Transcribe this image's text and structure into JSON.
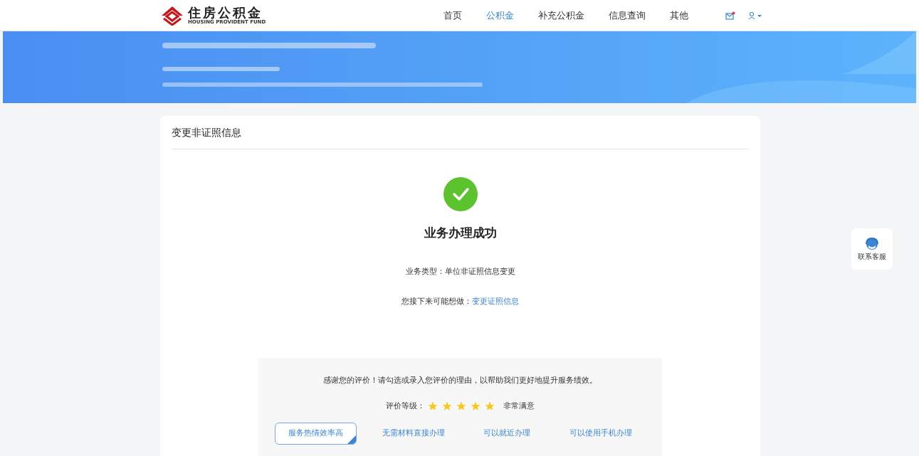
{
  "header": {
    "logo": {
      "title": "住房公积金",
      "subtitle": "HOUSING PROVIDENT FUND"
    },
    "nav": [
      {
        "label": "首页",
        "selected": false
      },
      {
        "label": "公积金",
        "selected": true
      },
      {
        "label": "补充公积金",
        "selected": false
      },
      {
        "label": "信息查询",
        "selected": false
      },
      {
        "label": "其他",
        "selected": false
      }
    ],
    "message_unread": true
  },
  "card": {
    "title": "变更非证照信息",
    "result": {
      "title": "业务办理成功",
      "type_label": "业务类型：",
      "type_value": "单位非证照信息变更",
      "next_label": "您接下来可能想做：",
      "next_link": "变更证照信息"
    },
    "rating": {
      "prompt": "感谢您的评价！请勾选或录入您评价的理由，以帮助我们更好地提升服务绩效。",
      "label": "评价等级：",
      "stars": 5,
      "verdict": "非常满意",
      "reasons": [
        {
          "label": "服务热情效率高",
          "selected": true
        },
        {
          "label": "无需材料直接办理",
          "selected": false
        },
        {
          "label": "可以就近办理",
          "selected": false
        },
        {
          "label": "可以使用手机办理",
          "selected": false
        }
      ]
    }
  },
  "service_button": {
    "label": "联系客服"
  }
}
